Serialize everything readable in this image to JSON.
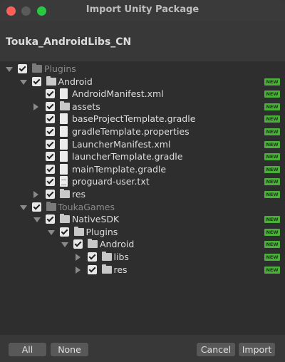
{
  "window": {
    "title": "Import Unity Package"
  },
  "package_name": "Touka_AndroidLibs_CN",
  "new_badge": "NEW",
  "tree": [
    {
      "label": "Plugins",
      "kind": "folder",
      "depth": 0,
      "arrow": "down",
      "dim": true,
      "new": false
    },
    {
      "label": "Android",
      "kind": "folder",
      "depth": 1,
      "arrow": "down",
      "dim": false,
      "new": true
    },
    {
      "label": "AndroidManifest.xml",
      "kind": "file",
      "depth": 2,
      "arrow": "none",
      "dim": false,
      "new": true
    },
    {
      "label": "assets",
      "kind": "folder",
      "depth": 2,
      "arrow": "right",
      "dim": false,
      "new": true
    },
    {
      "label": "baseProjectTemplate.gradle",
      "kind": "file",
      "depth": 2,
      "arrow": "none",
      "dim": false,
      "new": true
    },
    {
      "label": "gradleTemplate.properties",
      "kind": "file",
      "depth": 2,
      "arrow": "none",
      "dim": false,
      "new": true
    },
    {
      "label": "LauncherManifest.xml",
      "kind": "file",
      "depth": 2,
      "arrow": "none",
      "dim": false,
      "new": true
    },
    {
      "label": "launcherTemplate.gradle",
      "kind": "file",
      "depth": 2,
      "arrow": "none",
      "dim": false,
      "new": true
    },
    {
      "label": "mainTemplate.gradle",
      "kind": "file",
      "depth": 2,
      "arrow": "none",
      "dim": false,
      "new": true
    },
    {
      "label": "proguard-user.txt",
      "kind": "txt",
      "depth": 2,
      "arrow": "none",
      "dim": false,
      "new": true
    },
    {
      "label": "res",
      "kind": "folder",
      "depth": 2,
      "arrow": "right",
      "dim": false,
      "new": true
    },
    {
      "label": "ToukaGames",
      "kind": "folder",
      "depth": 1,
      "arrow": "down",
      "dim": true,
      "new": false
    },
    {
      "label": "NativeSDK",
      "kind": "folder",
      "depth": 2,
      "arrow": "down",
      "dim": false,
      "new": true
    },
    {
      "label": "Plugins",
      "kind": "folder",
      "depth": 3,
      "arrow": "down",
      "dim": false,
      "new": true
    },
    {
      "label": "Android",
      "kind": "folder",
      "depth": 4,
      "arrow": "down",
      "dim": false,
      "new": true
    },
    {
      "label": "libs",
      "kind": "folder",
      "depth": 5,
      "arrow": "right",
      "dim": false,
      "new": true
    },
    {
      "label": "res",
      "kind": "folder",
      "depth": 5,
      "arrow": "right",
      "dim": false,
      "new": true
    }
  ],
  "buttons": {
    "all": "All",
    "none": "None",
    "cancel": "Cancel",
    "import": "Import"
  },
  "colors": {
    "new_badge": "#4ab03a",
    "background": "#383838",
    "tree_background": "#2e2e2e"
  }
}
